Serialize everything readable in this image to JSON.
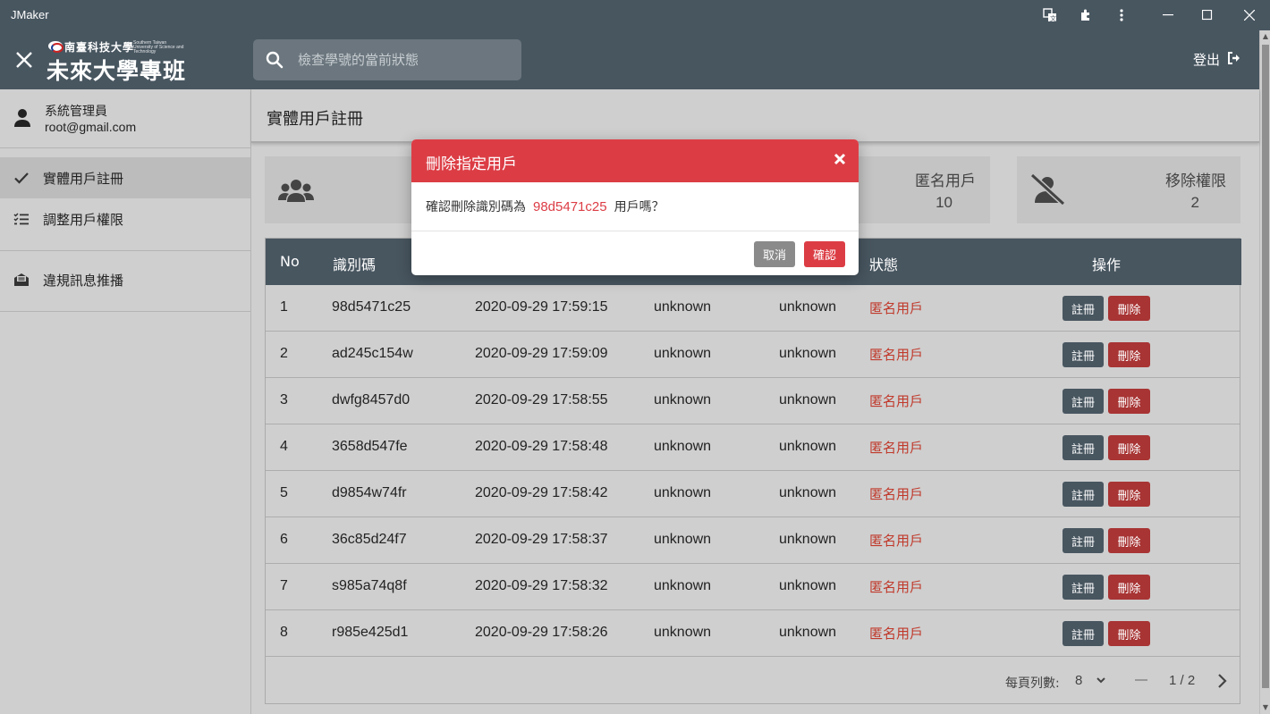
{
  "window": {
    "title": "JMaker"
  },
  "header": {
    "logo_university": "南臺科技大學",
    "logo_university_en": "Southern Taiwan University of Science and Technology",
    "logo_title": "未來大學專班",
    "search_placeholder": "檢查學號的當前狀態",
    "logout_label": "登出"
  },
  "sidebar": {
    "user_name": "系統管理員",
    "user_email": "root@gmail.com",
    "items": [
      {
        "label": "實體用戶註冊",
        "icon": "check-icon",
        "active": true
      },
      {
        "label": "調整用戶權限",
        "icon": "checklist-icon",
        "active": false
      },
      {
        "label": "違規訊息推播",
        "icon": "envelope-icon",
        "active": false
      }
    ]
  },
  "main": {
    "title": "實體用戶註冊",
    "cards": [
      {
        "label": "匿名用戶",
        "value": "10",
        "icon": "users-group-icon"
      },
      {
        "label": "移除權限",
        "value": "2",
        "icon": "user-slash-icon"
      }
    ]
  },
  "table": {
    "headers": [
      "No",
      "識別碼",
      "狀態",
      "操作"
    ],
    "register_label": "註冊",
    "delete_label": "刪除",
    "rows": [
      {
        "no": "1",
        "id": "98d5471c25",
        "time": "2020-09-29 17:59:15",
        "c1": "unknown",
        "c2": "unknown",
        "status": "匿名用戶"
      },
      {
        "no": "2",
        "id": "ad245c154w",
        "time": "2020-09-29 17:59:09",
        "c1": "unknown",
        "c2": "unknown",
        "status": "匿名用戶"
      },
      {
        "no": "3",
        "id": "dwfg8457d0",
        "time": "2020-09-29 17:58:55",
        "c1": "unknown",
        "c2": "unknown",
        "status": "匿名用戶"
      },
      {
        "no": "4",
        "id": "3658d547fe",
        "time": "2020-09-29 17:58:48",
        "c1": "unknown",
        "c2": "unknown",
        "status": "匿名用戶"
      },
      {
        "no": "5",
        "id": "d9854w74fr",
        "time": "2020-09-29 17:58:42",
        "c1": "unknown",
        "c2": "unknown",
        "status": "匿名用戶"
      },
      {
        "no": "6",
        "id": "36c85d24f7",
        "time": "2020-09-29 17:58:37",
        "c1": "unknown",
        "c2": "unknown",
        "status": "匿名用戶"
      },
      {
        "no": "7",
        "id": "s985a74q8f",
        "time": "2020-09-29 17:58:32",
        "c1": "unknown",
        "c2": "unknown",
        "status": "匿名用戶"
      },
      {
        "no": "8",
        "id": "r985e425d1",
        "time": "2020-09-29 17:58:26",
        "c1": "unknown",
        "c2": "unknown",
        "status": "匿名用戶"
      }
    ],
    "pager": {
      "rows_per_page_label": "每頁列數:",
      "rows_per_page": "8",
      "page_info": "1 / 2"
    }
  },
  "modal": {
    "title": "刪除指定用戶",
    "message_prefix": "確認刪除識別碼為",
    "target_id": "98d5471c25",
    "message_suffix": "用戶嗎？",
    "cancel_label": "取消",
    "confirm_label": "確認"
  },
  "colors": {
    "header": "#485660",
    "danger": "#dc3d45",
    "delete_button": "#a83434",
    "background": "#cfcfcf"
  }
}
